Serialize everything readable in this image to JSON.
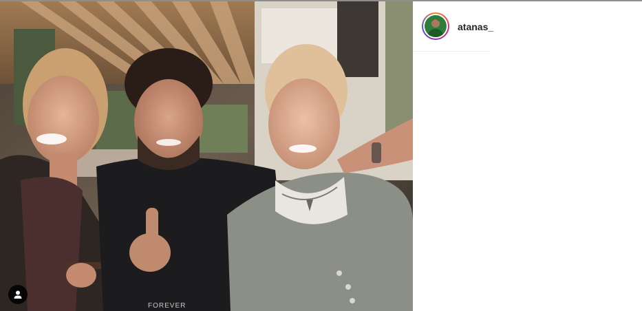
{
  "post": {
    "username": "atanas_"
  },
  "icons": {
    "user_tag": "person-icon",
    "avatar": "profile-avatar"
  },
  "colors": {
    "username_text": "#262626",
    "story_ring_start": "#f58529",
    "story_ring_end": "#515bd4"
  }
}
